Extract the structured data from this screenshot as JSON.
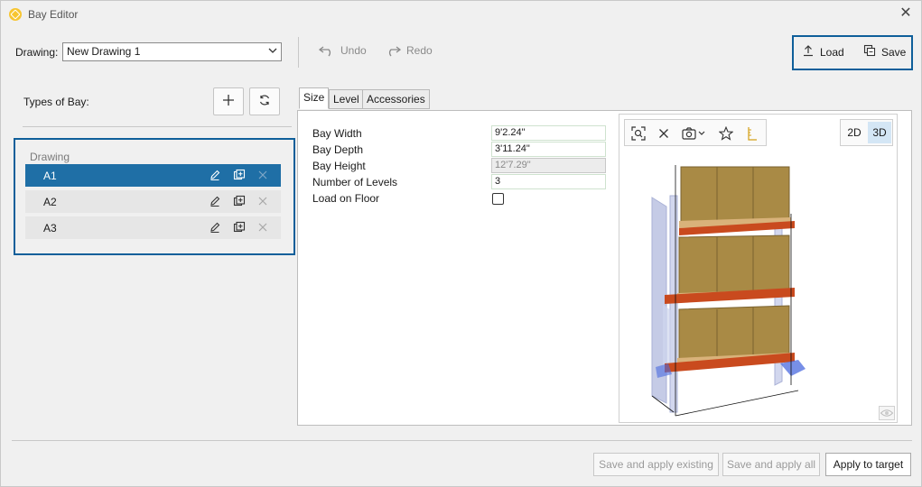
{
  "window": {
    "title": "Bay Editor"
  },
  "toolbar": {
    "drawing_label": "Drawing:",
    "drawing_value": "New Drawing 1",
    "undo_label": "Undo",
    "redo_label": "Redo",
    "load_label": "Load",
    "save_label": "Save"
  },
  "left": {
    "types_label": "Types of Bay:",
    "group_label": "Drawing",
    "bays": [
      {
        "name": "A1",
        "selected": true
      },
      {
        "name": "A2",
        "selected": false
      },
      {
        "name": "A3",
        "selected": false
      }
    ]
  },
  "tabs": [
    {
      "label": "Size",
      "active": true
    },
    {
      "label": "Level",
      "active": false
    },
    {
      "label": "Accessories",
      "active": false
    }
  ],
  "size": {
    "bay_width_label": "Bay Width",
    "bay_width": "9'2.24\"",
    "bay_depth_label": "Bay Depth",
    "bay_depth": "3'11.24\"",
    "bay_height_label": "Bay Height",
    "bay_height": "12'7.29\"",
    "levels_label": "Number of Levels",
    "levels": "3",
    "load_floor_label": "Load on Floor",
    "load_floor": false
  },
  "viewer": {
    "view_2d": "2D",
    "view_3d": "3D",
    "active_view": "3D",
    "tools": [
      "zoom-fit-icon",
      "clear-icon",
      "camera-icon",
      "star-icon",
      "ruler-icon"
    ]
  },
  "footer": {
    "save_apply_existing": "Save and apply existing",
    "save_apply_all": "Save and apply all",
    "apply_target": "Apply to target"
  },
  "colors": {
    "accent": "#1f6fa6",
    "highlight_border": "#0f5f9a",
    "beam": "#c94a1e",
    "box": "#a98a45",
    "pallet": "#d9b27a"
  }
}
